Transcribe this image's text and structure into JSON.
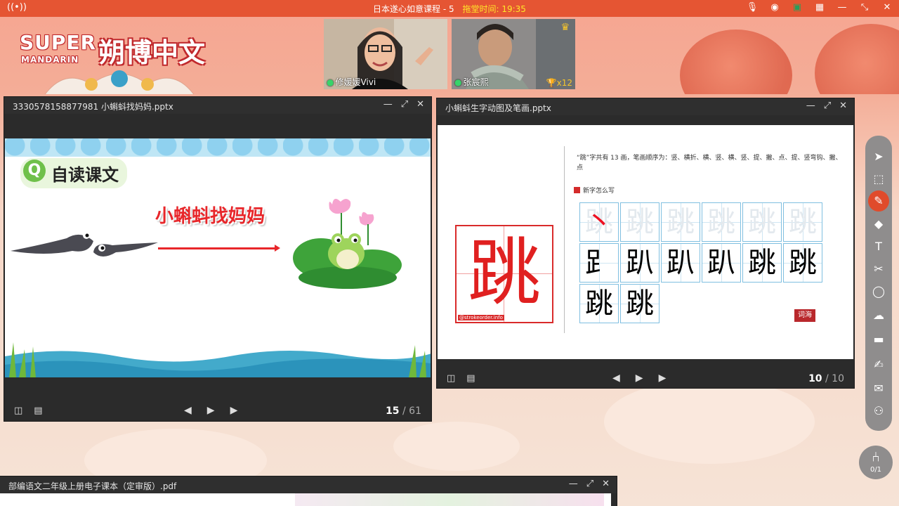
{
  "topbar": {
    "course_title": "日本遂心如意课程 - 5",
    "class_time_label": "拖堂时间: 19:35",
    "icons": [
      "live-icon",
      "mic-icon",
      "camera-icon",
      "screen-icon",
      "grid-icon",
      "minimize-icon",
      "restore-icon",
      "close-icon"
    ]
  },
  "logo": {
    "line1": "SUPER",
    "line2": "MANDARIN",
    "chinese": "朔博中文"
  },
  "videos": [
    {
      "name": "修媛媛Vivi",
      "trophy": ""
    },
    {
      "name": "张宸熙",
      "trophy": "x12"
    }
  ],
  "win1": {
    "title": "3330578158877981 小蝌蚪找妈妈.pptx",
    "slide": {
      "section_label": "自读课文",
      "title": "小蝌蚪找妈妈"
    },
    "page_current": "15",
    "page_sep": " / ",
    "page_total": "61"
  },
  "win2": {
    "title": "小蝌蚪生字动图及笔画.pptx",
    "slide": {
      "description": "“跳”字共有 13 画，笔画顺序为：竖、横折、横、竖、横、竖、提、撇、点、提、竖弯钩、撇、点",
      "subtitle": "新字怎么写",
      "big_char_left": "",
      "big_char": "跳",
      "watermark": "@strokeorder.info",
      "strokes": [
        "丨",
        "冂",
        "口",
        "口",
        "早",
        "足",
        "⻊",
        "趴",
        "趴",
        "趴",
        "跳",
        "跳",
        "跳",
        "跳"
      ],
      "cihai": "词海"
    },
    "page_current": "10",
    "page_sep": " / ",
    "page_total": "10"
  },
  "win3": {
    "title": "部编语文二年级上册电子课本（定审版）.pdf"
  },
  "seat": {
    "count": "0/1"
  },
  "colors": {
    "topbar": "#e55533",
    "accent_red": "#e8262a",
    "toolbar_gray": "#8f8d8d",
    "window_dark": "#2b2b2b"
  }
}
